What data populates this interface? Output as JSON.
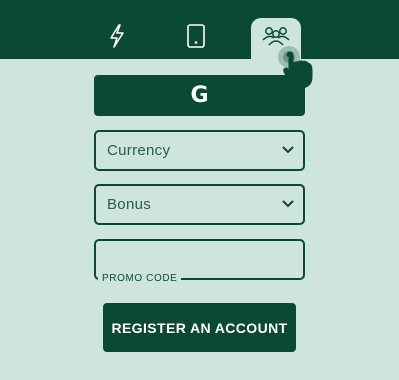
{
  "tabs": [
    {
      "icon": "lightning-icon",
      "active": false
    },
    {
      "icon": "tablet-icon",
      "active": false
    },
    {
      "icon": "people-icon",
      "active": true
    }
  ],
  "google_button": {
    "label": "G"
  },
  "currency_select": {
    "value": "Currency"
  },
  "bonus_select": {
    "value": "Bonus"
  },
  "promo_code": {
    "label": "PROMO CODE",
    "value": ""
  },
  "register_button": {
    "label": "REGISTER AN ACCOUNT"
  },
  "colors": {
    "primary": "#0a4a34",
    "background": "#cde5dd",
    "muted_text": "#2d5a4b"
  }
}
